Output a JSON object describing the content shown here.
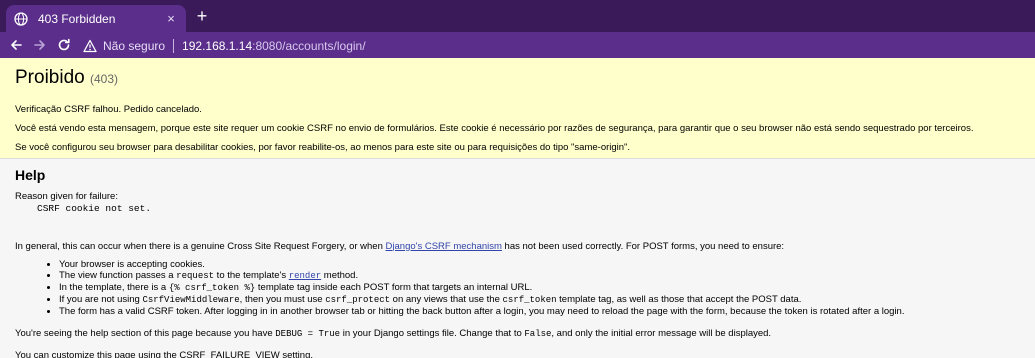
{
  "browser": {
    "tab_title": "403 Forbidden",
    "new_tab_label": "+",
    "close_label": "×",
    "security_label": "Não seguro",
    "url_host": "192.168.1.14",
    "url_rest": ":8080/accounts/login/"
  },
  "summary": {
    "title": "Proibido",
    "code": "(403)",
    "lines": [
      "Verificação CSRF falhou. Pedido cancelado.",
      "Você está vendo esta mensagem, porque este site requer um cookie CSRF no envio de formulários. Este cookie é necessário por razões de segurança, para garantir que o seu browser não está sendo sequestrado por terceiros.",
      "Se você configurou seu browser para desabilitar cookies, por favor reabilite-os, ao menos para este site ou para requisições do tipo \"same-origin\"."
    ]
  },
  "help": {
    "heading": "Help",
    "reason_label": "Reason given for failure:",
    "reason_value": "CSRF cookie not set.",
    "intro_before": "In general, this can occur when there is a genuine Cross Site Request Forgery, or when ",
    "intro_link": "Django's CSRF mechanism",
    "intro_after": " has not been used correctly. For POST forms, you need to ensure:",
    "bullets": {
      "b1": "Your browser is accepting cookies.",
      "b2_a": "The view function passes a ",
      "b2_code": "request",
      "b2_b": " to the template's ",
      "b2_link": "render",
      "b2_c": " method.",
      "b3_a": "In the template, there is a ",
      "b3_code": "{% csrf_token %}",
      "b3_b": " template tag inside each POST form that targets an internal URL.",
      "b4_a": "If you are not using ",
      "b4_code1": "CsrfViewMiddleware",
      "b4_b": ", then you must use ",
      "b4_code2": "csrf_protect",
      "b4_c": " on any views that use the ",
      "b4_code3": "csrf_token",
      "b4_d": " template tag, as well as those that accept the POST data.",
      "b5": "The form has a valid CSRF token. After logging in in another browser tab or hitting the back button after a login, you may need to reload the page with the form, because the token is rotated after a login."
    },
    "debug_a": "You're seeing the help section of this page because you have ",
    "debug_code1": "DEBUG = True",
    "debug_b": " in your Django settings file. Change that to ",
    "debug_code2": "False",
    "debug_c": ", and only the initial error message will be displayed.",
    "customize": "You can customize this page using the CSRF_FAILURE_VIEW setting."
  }
}
